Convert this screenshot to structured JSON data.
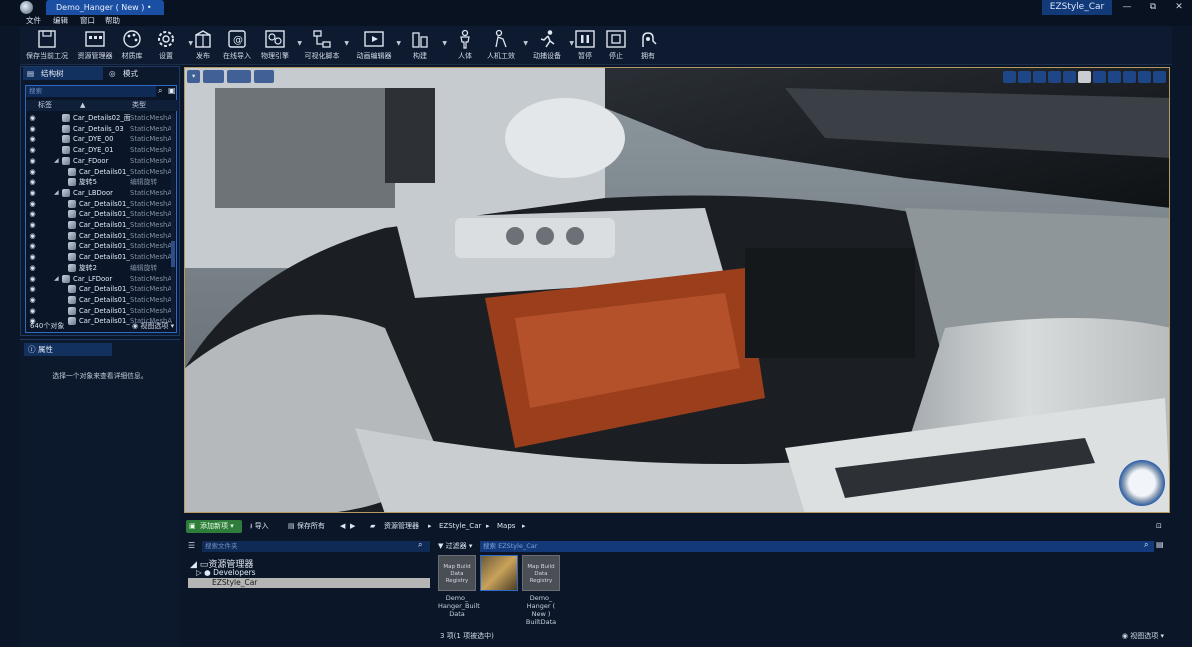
{
  "window": {
    "doc_tab": "Demo_Hanger ( New ) •",
    "project_name": "EZStyle_Car",
    "controls": [
      "—",
      "⧉",
      "✕"
    ]
  },
  "menu": [
    "文件",
    "编辑",
    "窗口",
    "帮助"
  ],
  "toolbar": [
    {
      "label": "保存当前工况",
      "icon": "save-icon"
    },
    {
      "label": "资源管理器",
      "icon": "asset-manager-icon"
    },
    {
      "label": "材质库",
      "icon": "palette-icon"
    },
    {
      "label": "设置",
      "icon": "gear-icon"
    },
    {
      "label": "发布",
      "icon": "publish-box-icon"
    },
    {
      "label": "在线导入",
      "icon": "online-import-icon"
    },
    {
      "label": "物理引擎",
      "icon": "physics-icon"
    },
    {
      "label": "可视化脚本",
      "icon": "visual-script-icon"
    },
    {
      "label": "动画编辑器",
      "icon": "animation-editor-icon"
    },
    {
      "label": "构建",
      "icon": "build-icon"
    },
    {
      "label": "人体",
      "icon": "human-body-icon"
    },
    {
      "label": "人机工效",
      "icon": "ergonomics-icon"
    },
    {
      "label": "动捕设备",
      "icon": "motion-capture-icon"
    },
    {
      "label": "暂停",
      "icon": "pause-icon"
    },
    {
      "label": "停止",
      "icon": "stop-icon"
    },
    {
      "label": "拥有",
      "icon": "possess-icon"
    }
  ],
  "outliner": {
    "tab_tree": "结构树",
    "tab_mode": "模式",
    "search_placeholder": "搜索",
    "col_label": "标签",
    "col_type": "类型",
    "rows": [
      {
        "name": "Car_Details02_面",
        "type": "StaticMeshA",
        "indent": 1,
        "expander": false
      },
      {
        "name": "Car_Details_03",
        "type": "StaticMeshA",
        "indent": 1,
        "expander": false
      },
      {
        "name": "Car_DYE_00",
        "type": "StaticMeshA",
        "indent": 1,
        "expander": false
      },
      {
        "name": "Car_DYE_01",
        "type": "StaticMeshA",
        "indent": 1,
        "expander": false
      },
      {
        "name": "Car_FDoor",
        "type": "StaticMeshA",
        "indent": 1,
        "expander": true
      },
      {
        "name": "Car_Details01_",
        "type": "StaticMeshA",
        "indent": 2,
        "expander": false
      },
      {
        "name": "旋转5",
        "type": "编辑旋转",
        "indent": 2,
        "expander": false
      },
      {
        "name": "Car_LBDoor",
        "type": "StaticMeshA",
        "indent": 1,
        "expander": true
      },
      {
        "name": "Car_Details01_",
        "type": "StaticMeshA",
        "indent": 2,
        "expander": false
      },
      {
        "name": "Car_Details01_",
        "type": "StaticMeshA",
        "indent": 2,
        "expander": false
      },
      {
        "name": "Car_Details01_",
        "type": "StaticMeshA",
        "indent": 2,
        "expander": false
      },
      {
        "name": "Car_Details01_",
        "type": "StaticMeshA",
        "indent": 2,
        "expander": false
      },
      {
        "name": "Car_Details01_",
        "type": "StaticMeshA",
        "indent": 2,
        "expander": false
      },
      {
        "name": "Car_Details01_",
        "type": "StaticMeshA",
        "indent": 2,
        "expander": false
      },
      {
        "name": "旋转2",
        "type": "编辑旋转",
        "indent": 2,
        "expander": false
      },
      {
        "name": "Car_LFDoor",
        "type": "StaticMeshA",
        "indent": 1,
        "expander": true
      },
      {
        "name": "Car_Details01_",
        "type": "StaticMeshA",
        "indent": 2,
        "expander": false
      },
      {
        "name": "Car_Details01_",
        "type": "StaticMeshA",
        "indent": 2,
        "expander": false
      },
      {
        "name": "Car_Details01_",
        "type": "StaticMeshA",
        "indent": 2,
        "expander": false
      },
      {
        "name": "Car_Details01_",
        "type": "StaticMeshA",
        "indent": 2,
        "expander": false
      }
    ],
    "object_count": "640个对象",
    "view_options": "视图选项"
  },
  "properties": {
    "tab": "属性",
    "hint": "选择一个对象来查看详细信息。"
  },
  "content_browser": {
    "add_new": "添加新项",
    "import": "导入",
    "save_all": "保存所有",
    "breadcrumb": [
      "资源管理器",
      "EZStyle_Car",
      "Maps"
    ],
    "folder_search_placeholder": "搜索文件夹",
    "tree_root": "资源管理器",
    "tree_developers": "Developers",
    "tree_selected": "EZStyle_Car",
    "filter": "过滤器",
    "asset_search_placeholder": "搜索 EZStyle_Car",
    "assets": [
      {
        "thumb_text": "Map Build Data Registry",
        "caption": "Demo_ Hanger_Built Data",
        "selected": false
      },
      {
        "thumb_text": "",
        "caption": "",
        "selected": true
      },
      {
        "thumb_text": "Map Build Data Registry",
        "caption": "Demo_ Hanger ( New ) BuiltData",
        "selected": false
      }
    ],
    "item_count": "3 项(1 项被选中)",
    "view_options": "视图选项"
  }
}
